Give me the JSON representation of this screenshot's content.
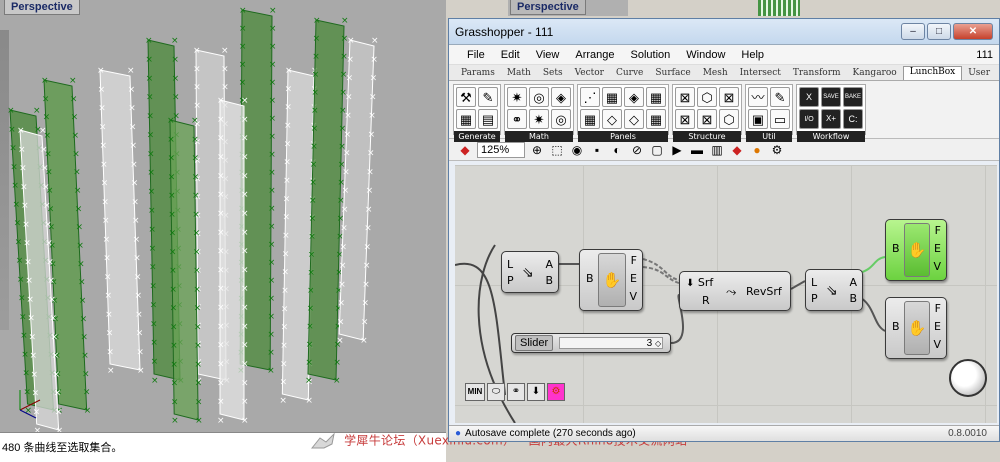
{
  "rhino": {
    "viewport_label": "Perspective",
    "viewport2_label": "Perspective",
    "command_line": "480 条曲线至选取集合。",
    "watermark": "学犀牛论坛（Xuexiniu.com）-- 国内最大Rhino技术交流网站"
  },
  "grasshopper": {
    "title": "Grasshopper - 111",
    "window_buttons": [
      "–",
      "□",
      "✕"
    ],
    "menus": [
      "File",
      "Edit",
      "View",
      "Arrange",
      "Solution",
      "Window",
      "Help"
    ],
    "document_name": "111",
    "tabs": [
      "Params",
      "Math",
      "Sets",
      "Vector",
      "Curve",
      "Surface",
      "Mesh",
      "Intersect",
      "Transform",
      "Kangaroo",
      "LunchBox",
      "User"
    ],
    "active_tab": "LunchBox",
    "ribbon_panels": [
      {
        "label": "Generate",
        "icons": [
          "⚒",
          "▦",
          "✎",
          "▤"
        ]
      },
      {
        "label": "Math",
        "icons": [
          "✷",
          "⚭",
          "◎",
          "✷",
          "◈",
          "◎"
        ]
      },
      {
        "label": "Panels",
        "icons": [
          "⋰",
          "▦",
          "▦",
          "◇",
          "◈",
          "◇",
          "▦",
          "▦"
        ]
      },
      {
        "label": "Structure",
        "icons": [
          "⊠",
          "⊠",
          "⬡",
          "⊠",
          "⊠",
          "⬡"
        ]
      },
      {
        "label": "Util",
        "icons": [
          "〰",
          "▣",
          "✎",
          "▭"
        ]
      },
      {
        "label": "Workflow",
        "icons": [
          "X",
          "I/O",
          "SAVE",
          "X+",
          "BAKE",
          "C:"
        ]
      }
    ],
    "zoom": "125%",
    "components": {
      "decompose1": {
        "inputs": [
          "L",
          "P"
        ],
        "outputs": [
          "A",
          "B"
        ]
      },
      "bake1": {
        "inputs": [
          "B"
        ],
        "outputs": [
          "F",
          "E",
          "V"
        ]
      },
      "revsrf": {
        "inputs": [
          "Srf",
          "R"
        ],
        "label": "RevSrf"
      },
      "decompose2": {
        "inputs": [
          "L",
          "P"
        ],
        "outputs": [
          "A",
          "B"
        ]
      },
      "bake_green": {
        "inputs": [
          "B"
        ],
        "outputs": [
          "F",
          "E",
          "V"
        ]
      },
      "bake2": {
        "inputs": [
          "B"
        ],
        "outputs": [
          "F",
          "E",
          "V"
        ]
      }
    },
    "slider": {
      "label": "Slider",
      "value": "3"
    },
    "bottom_widgets": [
      "MIN",
      "⬭",
      "⚭",
      "⬇",
      "⚙"
    ],
    "status_text": "Autosave complete (270 seconds ago)",
    "version": "0.8.0010"
  },
  "colors": {
    "window_border": "#5f7fa5",
    "green_component": "#6cd240",
    "canvas": "#d6d6d2",
    "viewport_bg": "#a9a9a9"
  }
}
